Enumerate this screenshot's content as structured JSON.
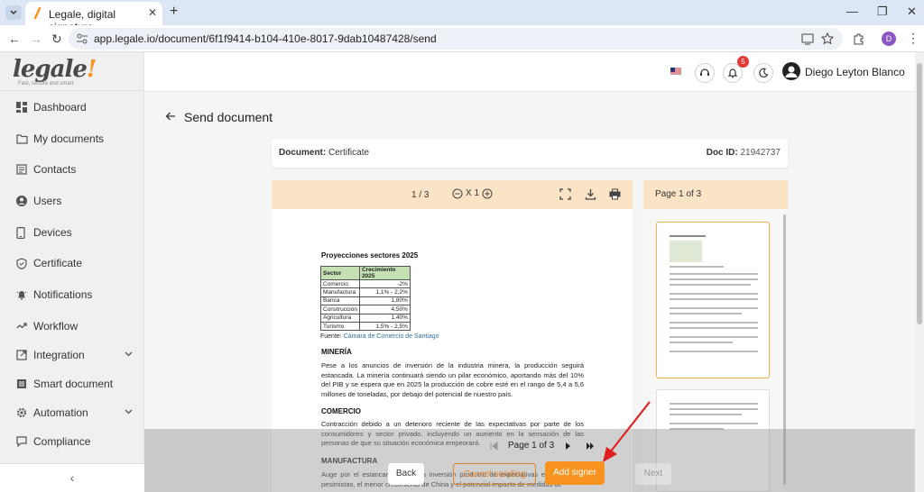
{
  "browser": {
    "tab_title": "Legale, digital signature",
    "url": "app.legale.io/document/6f1f9414-b104-410e-8017-9dab10487428/send",
    "profile_initial": "D"
  },
  "brand": {
    "logo_text": "legale",
    "tagline": "Fast, secure and smart"
  },
  "sidebar": {
    "items": [
      {
        "label": "Dashboard",
        "icon": "dashboard-icon"
      },
      {
        "label": "My documents",
        "icon": "folder-icon"
      },
      {
        "label": "Contacts",
        "icon": "contacts-icon"
      },
      {
        "label": "Users",
        "icon": "user-icon"
      },
      {
        "label": "Devices",
        "icon": "device-icon"
      },
      {
        "label": "Certificate",
        "icon": "shield-icon"
      },
      {
        "label": "Notifications",
        "icon": "notification-icon"
      },
      {
        "label": "Workflow",
        "icon": "workflow-icon"
      },
      {
        "label": "Integration",
        "icon": "integration-icon"
      },
      {
        "label": "Smart document",
        "icon": "smart-document-icon"
      },
      {
        "label": "Automation",
        "icon": "gear-icon"
      },
      {
        "label": "Compliance",
        "icon": "chat-icon"
      }
    ],
    "collapse_glyph": "‹"
  },
  "header": {
    "notification_count": "5",
    "user_name": "Diego Leyton Blanco"
  },
  "page": {
    "title": "Send document"
  },
  "document": {
    "label": "Document:",
    "name": "Certificate",
    "id_label": "Doc ID:",
    "id": "21942737"
  },
  "viewer": {
    "page_count": "1 / 3",
    "zoom": "X 1"
  },
  "thumbs": {
    "title": "Page 1 of 3"
  },
  "doc_content": {
    "title": "Proyecciones sectores 2025",
    "table_headers": [
      "Sector",
      "Crecimiento 2025"
    ],
    "table_rows": [
      [
        "Comercio",
        "-2%"
      ],
      [
        "Manufactura",
        "1,1% - 2,2%"
      ],
      [
        "Banca",
        "1,80%"
      ],
      [
        "Construcción",
        "4,50%"
      ],
      [
        "Agricultura",
        "1,40%"
      ],
      [
        "Turismo",
        "1,5% - 2,5%"
      ]
    ],
    "source_label": "Fuente:",
    "source_link": "Cámara de Comercio de Santiago",
    "h_mineria": "MINERÍA",
    "p_mineria": "Pese a los anuncios de inversión de la industria minera, la producción seguirá estancada. La minería continuará siendo un pilar económico, aportando más del 10% del PIB y se espera que en 2025 la producción de cobre esté en el rango de 5,4 a 5,6 millones de toneladas, por debajo del potencial de nuestro país.",
    "h_comercio": "COMERCIO",
    "p_comercio": "Contracción debido a un deterioro reciente de las expectativas por parte de los consumidores y sector privado, incluyendo un aumento en la sensación de las personas de que su situación económica empeorará.",
    "h_manufactura": "MANUFACTURA",
    "p_manufactura": "Auge por el estancamiento de la inversión producto de expectativas empresariales pesimistas, el menor crecimiento de China y el potencial impacto de medidas de"
  },
  "footer": {
    "pager": "Page 1 of 3",
    "back": "Back",
    "cancel": "Cancel sending",
    "add_signer": "Add signer",
    "next": "Next"
  },
  "colors": {
    "accent": "#f7931e",
    "panel": "#fbe3c6",
    "arrow": "#e02020"
  }
}
